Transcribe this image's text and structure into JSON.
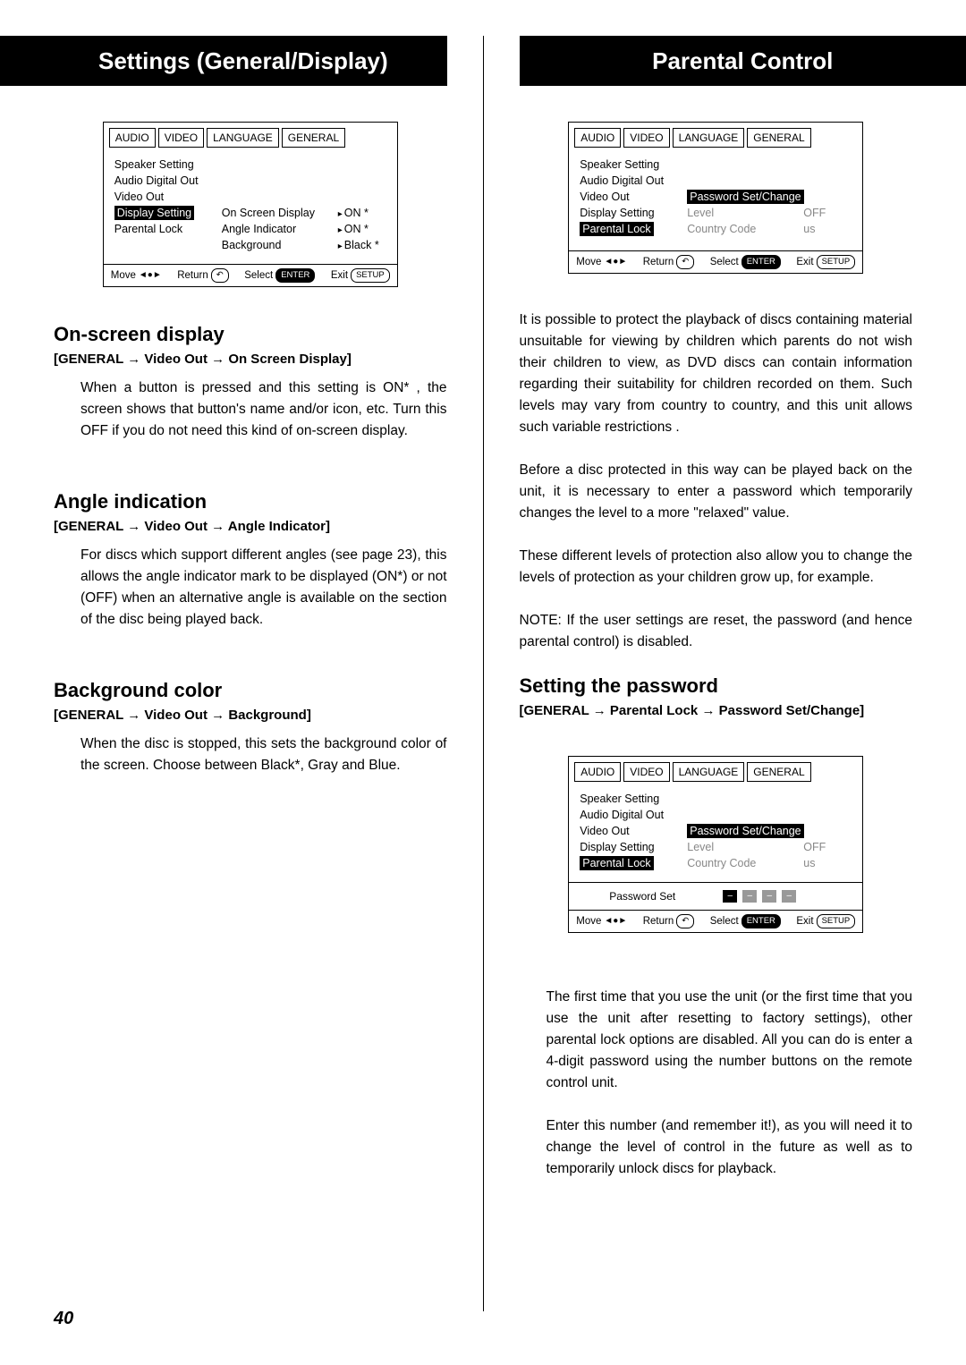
{
  "page_number": "40",
  "left": {
    "title": "Settings (General/Display)",
    "osd1": {
      "tabs": [
        "AUDIO",
        "VIDEO",
        "LANGUAGE",
        "GENERAL"
      ],
      "menu": [
        "Speaker Setting",
        "Audio Digital Out",
        "Video Out",
        "Display Setting",
        "Parental Lock"
      ],
      "sub": [
        {
          "label": "On Screen Display",
          "val": "ON *"
        },
        {
          "label": "Angle Indicator",
          "val": "ON *"
        },
        {
          "label": "Background",
          "val": "Black *"
        }
      ],
      "footer": {
        "move": "Move",
        "return": "Return",
        "select": "Select",
        "select_btn": "ENTER",
        "exit": "Exit",
        "exit_btn": "SETUP"
      }
    },
    "s1": {
      "heading": "On-screen display",
      "crumb_a": "[GENERAL",
      "crumb_b": "Video Out",
      "crumb_c": "On Screen Display]",
      "body": "When a button is pressed and this setting is ON* , the screen shows that button's name and/or icon, etc. Turn this OFF if you do not need this kind of on-screen display."
    },
    "s2": {
      "heading": "Angle indication",
      "crumb_a": "[GENERAL",
      "crumb_b": "Video Out",
      "crumb_c": "Angle Indicator]",
      "body": "For discs which support different angles (see page 23), this allows the angle indicator mark to be displayed (ON*) or not (OFF) when an alternative angle is available on the section of the disc being played back."
    },
    "s3": {
      "heading": "Background color",
      "crumb_a": "[GENERAL",
      "crumb_b": "Video Out",
      "crumb_c": "Background]",
      "body": "When the disc is stopped, this sets the background color of the screen. Choose between Black*, Gray and Blue."
    }
  },
  "right": {
    "title": "Parental Control",
    "osd2": {
      "tabs": [
        "AUDIO",
        "VIDEO",
        "LANGUAGE",
        "GENERAL"
      ],
      "menu": [
        "Speaker Setting",
        "Audio Digital Out",
        "Video Out",
        "Display Setting",
        "Parental Lock"
      ],
      "sub": [
        {
          "label": "Password Set/Change",
          "val": ""
        },
        {
          "label": "Level",
          "val": "OFF"
        },
        {
          "label": "Country Code",
          "val": "us"
        }
      ],
      "footer": {
        "move": "Move",
        "return": "Return",
        "select": "Select",
        "select_btn": "ENTER",
        "exit": "Exit",
        "exit_btn": "SETUP"
      }
    },
    "p1": "It is possible to protect the playback of discs containing material unsuitable for viewing by children which parents do not wish their children to view, as DVD discs can contain information regarding their suitability for children recorded on them. Such levels may vary from country to country, and this unit allows such variable restrictions .",
    "p2": "Before a disc protected in this way can be played back on the unit, it is necessary to enter a password which temporarily changes the level to a more \"relaxed\" value.",
    "p3": "These different levels of protection also allow you to change the levels of protection as your children grow up, for example.",
    "p4": "NOTE: If the user settings are reset, the password (and hence parental control) is disabled.",
    "s4": {
      "heading": "Setting the password",
      "crumb_a": "[GENERAL",
      "crumb_b": "Parental Lock",
      "crumb_c": "Password Set/Change]"
    },
    "osd3": {
      "tabs": [
        "AUDIO",
        "VIDEO",
        "LANGUAGE",
        "GENERAL"
      ],
      "menu": [
        "Speaker Setting",
        "Audio Digital Out",
        "Video Out",
        "Display Setting",
        "Parental Lock"
      ],
      "sub": [
        {
          "label": "Password Set/Change",
          "val": ""
        },
        {
          "label": "Level",
          "val": "OFF"
        },
        {
          "label": "Country Code",
          "val": "us"
        }
      ],
      "pw_label": "Password Set",
      "footer": {
        "move": "Move",
        "return": "Return",
        "select": "Select",
        "select_btn": "ENTER",
        "exit": "Exit",
        "exit_btn": "SETUP"
      }
    },
    "p5": "The first time that you use the unit (or the first time that you use the unit after resetting to factory settings), other parental lock options are disabled. All you can do is enter a 4-digit password using the number buttons on the remote control unit.",
    "p6": "Enter this number (and remember it!), as you will need it to change the level of control in the future as well as to temporarily unlock discs for playback."
  }
}
